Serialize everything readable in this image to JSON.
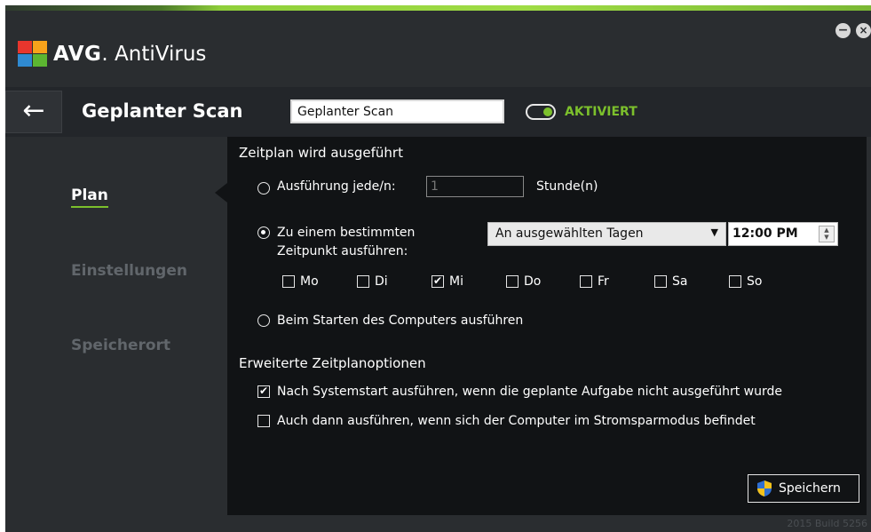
{
  "app": {
    "brand": "AVG",
    "product": "AntiVirus",
    "accent": "#7cc02c"
  },
  "window_controls": {
    "minimize": "−",
    "close": "×"
  },
  "header": {
    "back_symbol": "←",
    "title": "Geplanter Scan",
    "name_value": "Geplanter Scan",
    "toggle_label": "AKTIVIERT"
  },
  "sidebar": {
    "items": [
      {
        "label": "Plan",
        "active": true
      },
      {
        "label": "Einstellungen",
        "active": false
      },
      {
        "label": "Speicherort",
        "active": false
      }
    ]
  },
  "schedule": {
    "section_title": "Zeitplan wird ausgeführt",
    "option_interval": "Ausführung jede/n:",
    "interval_value": "1",
    "interval_unit": "Stunde(n)",
    "option_specific_line1": "Zu einem bestimmten",
    "option_specific_line2": "Zeitpunkt ausführen:",
    "days_mode": "An ausgewählten Tagen",
    "time": "12:00 PM",
    "days": [
      {
        "label": "Mo",
        "checked": false
      },
      {
        "label": "Di",
        "checked": false
      },
      {
        "label": "Mi",
        "checked": true
      },
      {
        "label": "Do",
        "checked": false
      },
      {
        "label": "Fr",
        "checked": false
      },
      {
        "label": "Sa",
        "checked": false
      },
      {
        "label": "So",
        "checked": false
      }
    ],
    "option_startup": "Beim Starten des Computers ausführen",
    "selected_option": "specific"
  },
  "advanced": {
    "section_title": "Erweiterte Zeitplanoptionen",
    "options": [
      {
        "label": "Nach Systemstart ausführen, wenn die geplante Aufgabe nicht ausgeführt wurde",
        "checked": true
      },
      {
        "label": "Auch dann ausführen, wenn sich der Computer im Stromsparmodus befindet",
        "checked": false
      }
    ]
  },
  "save_button": "Speichern",
  "footer": {
    "build": "2015  Build 5256"
  }
}
